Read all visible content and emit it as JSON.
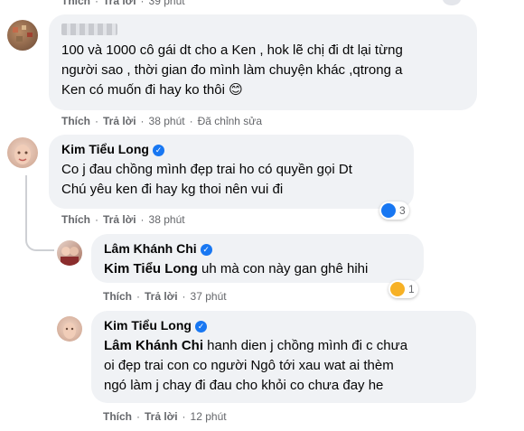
{
  "top_partial": {
    "actions": {
      "like": "Thích",
      "reply": "Trả lời",
      "time": "39 phút"
    }
  },
  "comment1": {
    "avatar": "avatar-nameless-user",
    "lines": [
      "100 và 1000 cô gái dt cho a Ken , hok lẽ chị đi dt lại từng",
      "người sao , thời gian đo mình làm chuyện khác ,qtrong a",
      "Ken có muốn đi hay ko thôi 😊"
    ],
    "actions": {
      "like": "Thích",
      "reply": "Trả lời",
      "time": "38 phút",
      "edited": "Đã chỉnh sửa"
    }
  },
  "comment2": {
    "name": "Kim Tiểu Long",
    "lines": [
      "Co j đau chồng mình đẹp trai ho có quyền gọi Dt",
      "Chú yêu ken đi hay kg thoi nên vui đi"
    ],
    "reaction_count": "3",
    "actions": {
      "like": "Thích",
      "reply": "Trả lời",
      "time": "38 phút"
    }
  },
  "comment3": {
    "name": "Lâm Khánh Chi",
    "mention": "Kim Tiểu Long",
    "text": " uh mà con này gan ghê hihi",
    "reaction_count": "1",
    "actions": {
      "like": "Thích",
      "reply": "Trả lời",
      "time": "37 phút"
    }
  },
  "comment4": {
    "name": "Kim Tiểu Long",
    "mention": "Lâm Khánh Chi",
    "line1_rest": " hanh dien j chồng mình đi c chưa",
    "lines": [
      "oi đẹp trai con co người Ngô tới xau wat ai thèm",
      "ngó làm j chay đi đau cho khỏi co chưa đay he"
    ],
    "actions": {
      "like": "Thích",
      "reply": "Trả lời",
      "time": "12 phút"
    }
  },
  "colors": {
    "bubble": "#f0f2f5",
    "meta": "#65676b",
    "verified": "#1877f2"
  }
}
